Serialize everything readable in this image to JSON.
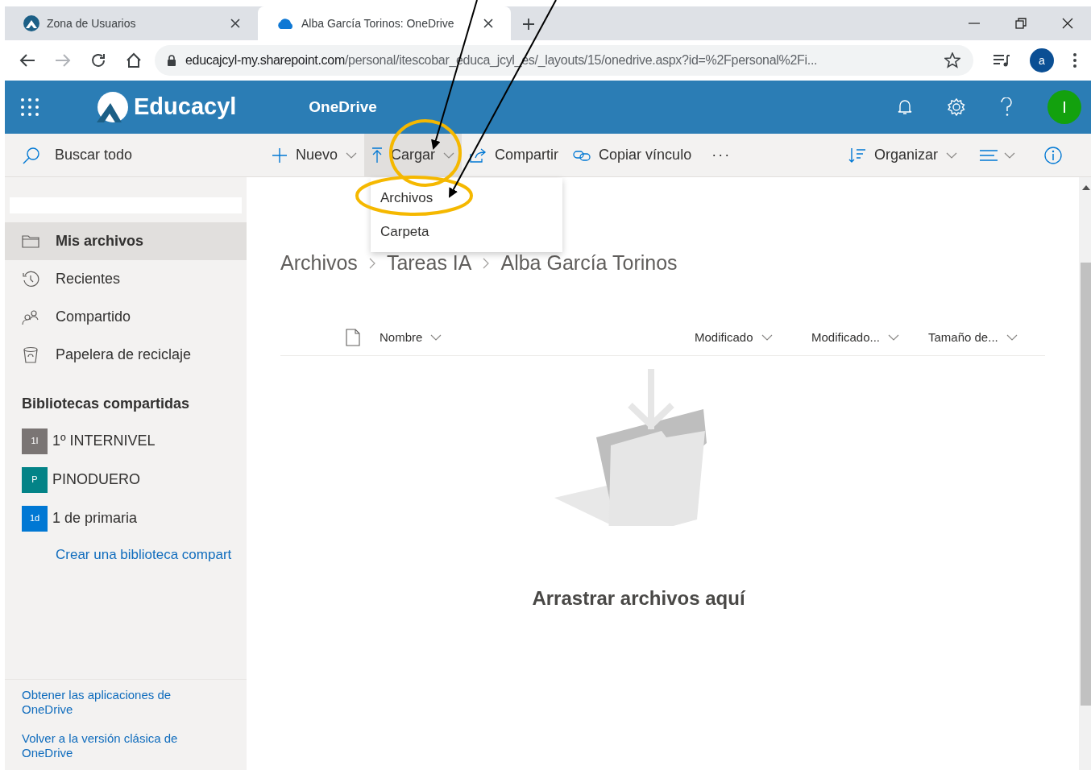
{
  "browser": {
    "tabs": [
      {
        "title": "Zona de Usuarios",
        "selected": false,
        "kind": "site"
      },
      {
        "title": "Alba García Torinos: OneDrive",
        "selected": true,
        "kind": "cloud"
      }
    ],
    "url_host": "educajcyl-my.sharepoint.com",
    "url_path": "/personal/itescobar_educa_jcyl_es/_layouts/15/onedrive.aspx?id=%2Fpersonal%2Fi...",
    "profile_initial": "a"
  },
  "suite_bar": {
    "brand": "Educacyl",
    "app": "OneDrive",
    "user_initial": "I"
  },
  "search": {
    "placeholder": "Buscar todo"
  },
  "command_bar": {
    "left": [
      {
        "label": "Nuevo",
        "kind": "plus",
        "dropdown": true,
        "selected": false
      },
      {
        "label": "Cargar",
        "kind": "upload",
        "dropdown": true,
        "selected": true
      },
      {
        "label": "Compartir",
        "kind": "share",
        "dropdown": false,
        "selected": false
      },
      {
        "label": "Copiar vínculo",
        "kind": "link",
        "dropdown": false,
        "selected": false
      }
    ],
    "more": "···",
    "sort": "Organizar"
  },
  "upload_menu": [
    "Archivos",
    "Carpeta"
  ],
  "sidebar": {
    "nav": [
      {
        "label": "Mis archivos",
        "kind": "folder",
        "selected": true
      },
      {
        "label": "Recientes",
        "kind": "history",
        "selected": false
      },
      {
        "label": "Compartido",
        "kind": "people",
        "selected": false
      },
      {
        "label": "Papelera de reciclaje",
        "kind": "bin",
        "selected": false
      }
    ],
    "libraries_title": "Bibliotecas compartidas",
    "libraries": [
      {
        "badge": "1I",
        "label": "1º INTERNIVEL",
        "color": "#7a7574"
      },
      {
        "badge": "P",
        "label": "PINODUERO",
        "color": "#038387"
      },
      {
        "badge": "1d",
        "label": "1 de primaria",
        "color": "#0078d4"
      }
    ],
    "create_link": "Crear una biblioteca compart",
    "footer_links": [
      "Obtener las aplicaciones de OneDrive",
      "Volver a la versión clásica de OneDrive"
    ]
  },
  "breadcrumb": [
    "Archivos",
    "Tareas IA",
    "Alba García Torinos"
  ],
  "table": {
    "columns": [
      "Nombre",
      "Modificado",
      "Modificado...",
      "Tamaño de..."
    ]
  },
  "empty_state": "Arrastrar archivos aquí"
}
